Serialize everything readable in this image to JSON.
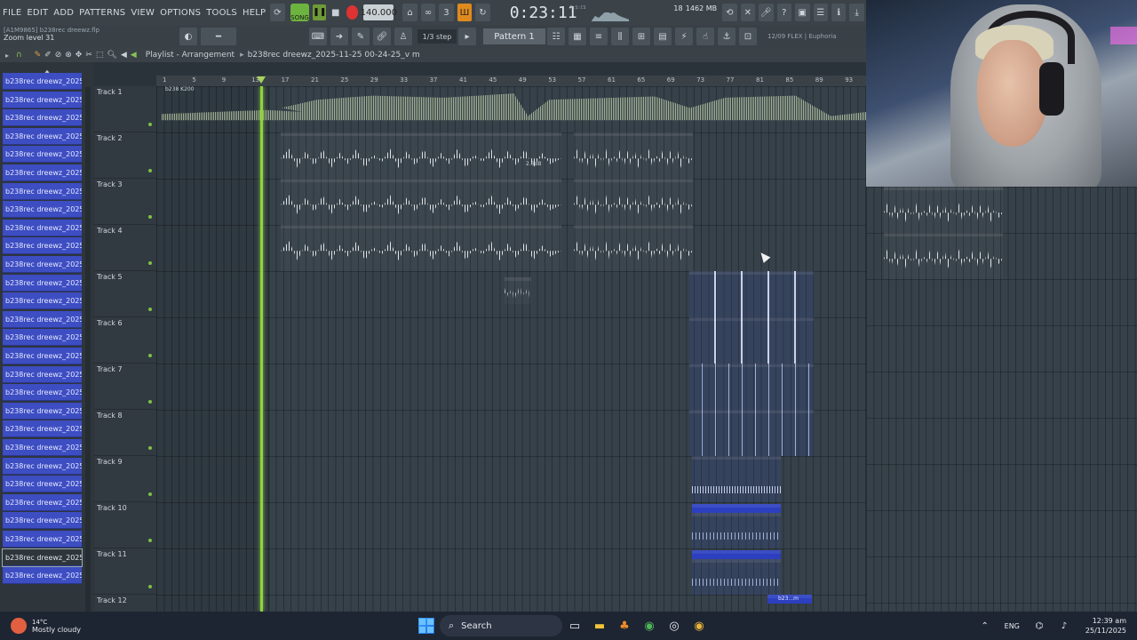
{
  "menu": [
    "FILE",
    "EDIT",
    "ADD",
    "PATTERNS",
    "VIEW",
    "OPTIONS",
    "TOOLS",
    "HELP"
  ],
  "transport": {
    "mode": "SONG",
    "tempo": "140.000",
    "time": "0:23:11",
    "time_unit": "M:S:CS"
  },
  "monitor": {
    "poly": "18",
    "memory": "1462 MB",
    "cpu": "1"
  },
  "hint": {
    "file": "[A1M9865] b238rec dreewz.flp",
    "text": "Zoom level 31"
  },
  "snap": "1/3 step",
  "pattern": "Pattern 1",
  "plugin_info": "12/09  FLEX | Euphoria",
  "playlist": {
    "title": "Playlist - Arrangement",
    "breadcrumb": "b238rec dreewz_2025-11-25 00-24-25_v m"
  },
  "ruler_ticks": [
    "1",
    "5",
    "9",
    "13",
    "17",
    "21",
    "25",
    "29",
    "33",
    "37",
    "41",
    "45",
    "49",
    "53",
    "57",
    "61",
    "65",
    "69",
    "73",
    "77",
    "81",
    "85",
    "89",
    "93"
  ],
  "channels": [
    "b238rec dreewz_2025-11...",
    "b238rec dreewz_2025-11...",
    "b238rec dreewz_2025-11...",
    "b238rec dreewz_2025-11...",
    "b238rec dreewz_2025-11...",
    "b238rec dreewz_2025-11...",
    "b238rec dreewz_2025-11...",
    "b238rec dreewz_2025-11...",
    "b238rec dreewz_2025-11...",
    "b238rec dreewz_2025-11...",
    "b238rec dreewz_2025-11...",
    "b238rec dreewz_2025-11...",
    "b238rec dreewz_2025-11...",
    "b238rec dreewz_2025-11...",
    "b238rec dreewz_2025-11...",
    "b238rec dreewz_2025-11...",
    "b238rec dreewz_2025-11...",
    "b238rec dreewz_2025-11...",
    "b238rec dreewz_2025-11...",
    "b238rec dreewz_2025-11...",
    "b238rec dreewz_2025-11...",
    "b238rec dreewz_2025-11...",
    "b238rec dreewz_2025-11...",
    "b238rec dreewz_2025-11...",
    "b238rec dreewz_2025-11...",
    "b238rec dreewz_2025-11...",
    "b238rec dreewz_2025-11...",
    "b238rec dreewz_2025-11..."
  ],
  "tracks": [
    "Track 1",
    "Track 2",
    "Track 3",
    "Track 4",
    "Track 5",
    "Track 6",
    "Track 7",
    "Track 8",
    "Track 9",
    "Track 10",
    "Track 11",
    "Track 12"
  ],
  "clip_labels": {
    "track1": "b238 K200",
    "track2_gain": "2.6dB",
    "track12": "b23...m"
  },
  "taskbar": {
    "weather_temp": "14°C",
    "weather_desc": "Mostly cloudy",
    "search": "Search",
    "lang": "ENG",
    "time": "12:39 am",
    "date": "25/11/2025"
  }
}
